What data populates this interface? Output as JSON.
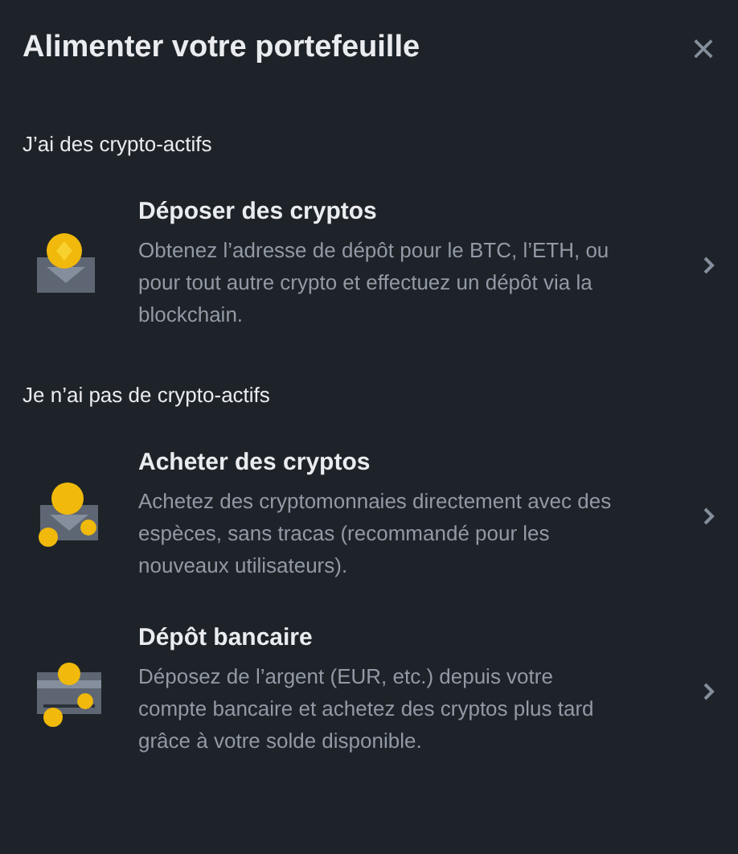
{
  "dialog": {
    "title": "Alimenter votre portefeuille",
    "close": "×"
  },
  "sections": [
    {
      "heading": "J’ai des crypto-actifs",
      "items": [
        {
          "kind": "deposit",
          "title": "Déposer des cryptos",
          "description": "Obtenez l’adresse de dépôt pour le BTC, l’ETH, ou pour tout autre crypto et effectuez un dépôt via la blockchain."
        }
      ]
    },
    {
      "heading": "Je n’ai pas de crypto-actifs",
      "items": [
        {
          "kind": "buy",
          "title": "Acheter des cryptos",
          "description": "Achetez des cryptomonnaies directement avec des espèces, sans tracas (recommandé pour les nouveaux utilisateurs)."
        },
        {
          "kind": "bank",
          "title": "Dépôt bancaire",
          "description": "Déposez de l’argent (EUR, etc.) depuis votre compte bancaire et achetez des cryptos plus tard grâce à votre solde disponible."
        }
      ]
    }
  ]
}
